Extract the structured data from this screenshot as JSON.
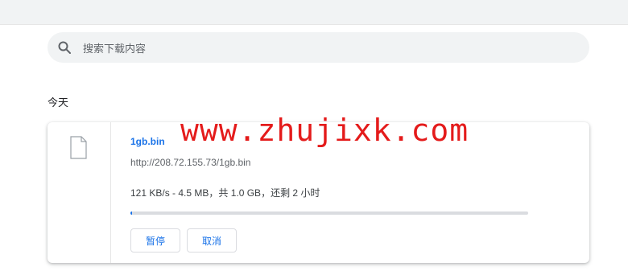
{
  "search": {
    "placeholder": "搜索下载内容",
    "icon": "search-icon"
  },
  "section": {
    "date_label": "今天"
  },
  "download": {
    "filename": "1gb.bin",
    "url": "http://208.72.155.73/1gb.bin",
    "status": "121 KB/s - 4.5 MB，共 1.0 GB，还剩 2 小时",
    "progress": 0.0044,
    "icon": "file-icon",
    "pause_label": "暂停",
    "cancel_label": "取消"
  },
  "watermark": {
    "text": "www.zhujixk.com"
  },
  "colors": {
    "accent": "#1a73e8",
    "watermark": "#e41b1b",
    "track": "#dadce0",
    "search_bg": "#f1f3f4"
  }
}
